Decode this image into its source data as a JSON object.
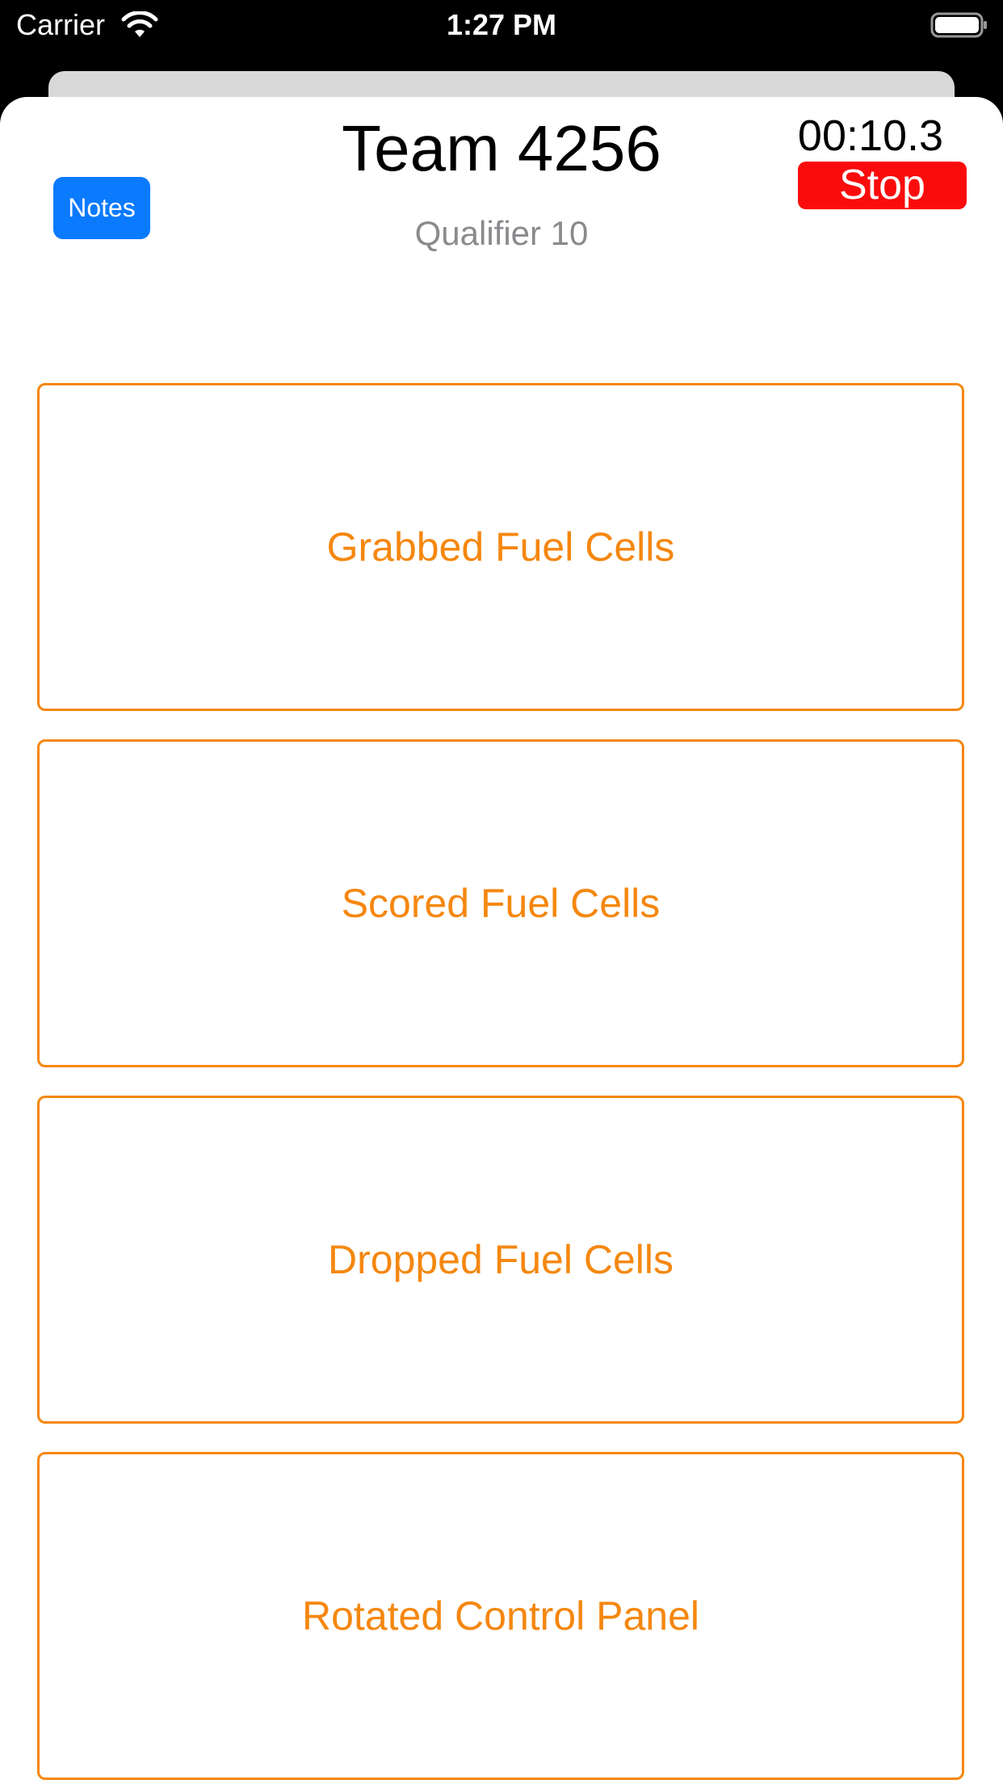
{
  "status_bar": {
    "carrier": "Carrier",
    "time": "1:27 PM",
    "wifi_icon": "wifi-icon",
    "battery_icon": "battery-icon"
  },
  "header": {
    "notes_label": "Notes",
    "team_title": "Team 4256",
    "match_subtitle": "Qualifier 10",
    "timer": "00:10.3",
    "stop_label": "Stop"
  },
  "actions": [
    {
      "label": "Grabbed Fuel Cells"
    },
    {
      "label": "Scored Fuel Cells"
    },
    {
      "label": "Dropped Fuel Cells"
    },
    {
      "label": "Rotated Control Panel"
    }
  ],
  "colors": {
    "accent": "#f5870f",
    "notes_blue": "#0a7aff",
    "stop_red": "#fa0c0c",
    "subtitle_gray": "#8a8a8e"
  }
}
